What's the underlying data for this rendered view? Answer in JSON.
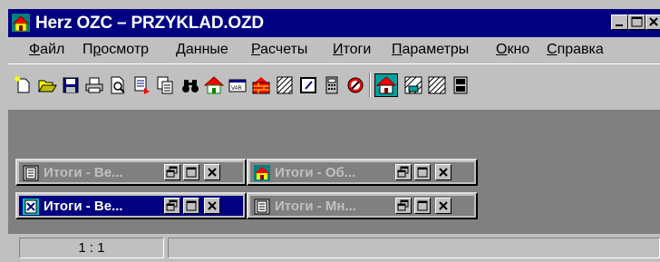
{
  "window": {
    "title": "Herz OZC – PRZYKLAD.OZD",
    "controls": [
      "minimize-icon",
      "restore-icon",
      "close-icon"
    ]
  },
  "menu": {
    "items": [
      "Файл",
      "Просмотр",
      "Данные",
      "Расчеты",
      "Итоги",
      "Параметры",
      "Окно",
      "Справка"
    ],
    "mnemonics": [
      "Ф",
      "р",
      "Д",
      "Р",
      "И",
      "П",
      "О",
      "С"
    ]
  },
  "toolbar": {
    "icons": [
      "new-file-icon",
      "open-folder-icon",
      "save-icon",
      "print-icon",
      "print-preview-icon",
      "export-icon",
      "copy-icon",
      "binoculars-icon",
      "house-icon",
      "variants-icon",
      "wall-icon",
      "hatched-layer-icon",
      "edit-window-icon",
      "calculator-icon",
      "stop-icon",
      "building-icon",
      "window-grid-icon",
      "insulation-icon",
      "door-icon"
    ]
  },
  "minimized_windows": [
    {
      "title": "Итоги - Ве...",
      "active": false,
      "icon": "document-icon"
    },
    {
      "title": "Итоги - Об...",
      "active": false,
      "icon": "house-icon"
    },
    {
      "title": "Итоги - Ве...",
      "active": true,
      "icon": "results-icon"
    },
    {
      "title": "Итоги - Мн...",
      "active": false,
      "icon": "document-icon"
    }
  ],
  "status": {
    "scale": "1 : 1",
    "message": ""
  },
  "colors": {
    "titlebar": "#000080",
    "face": "#c0c0c0",
    "workspace": "#808080"
  }
}
